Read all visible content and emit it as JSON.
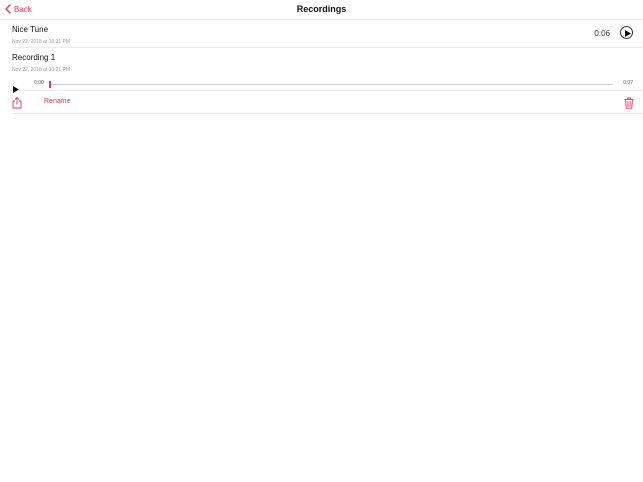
{
  "nav": {
    "back_label": "Back",
    "title": "Recordings"
  },
  "recordings": [
    {
      "name": "Nice Tune",
      "date": "Nov 22, 2018 at 10:21 PM",
      "duration": "0:06"
    },
    {
      "name": "Recording 1",
      "date": "Nov 22, 2018 at 10:21 PM",
      "current_time": "0:00",
      "total_time": "0:07",
      "progress": 0.0
    }
  ],
  "actions": {
    "rename_label": "Rename"
  },
  "icons": {
    "back": "chevron-left-icon",
    "play": "play-icon",
    "share": "share-icon",
    "trash": "trash-icon"
  },
  "colors": {
    "accent": "#e8335c",
    "separator": "#ececef",
    "date_text": "#9a9aa0"
  }
}
